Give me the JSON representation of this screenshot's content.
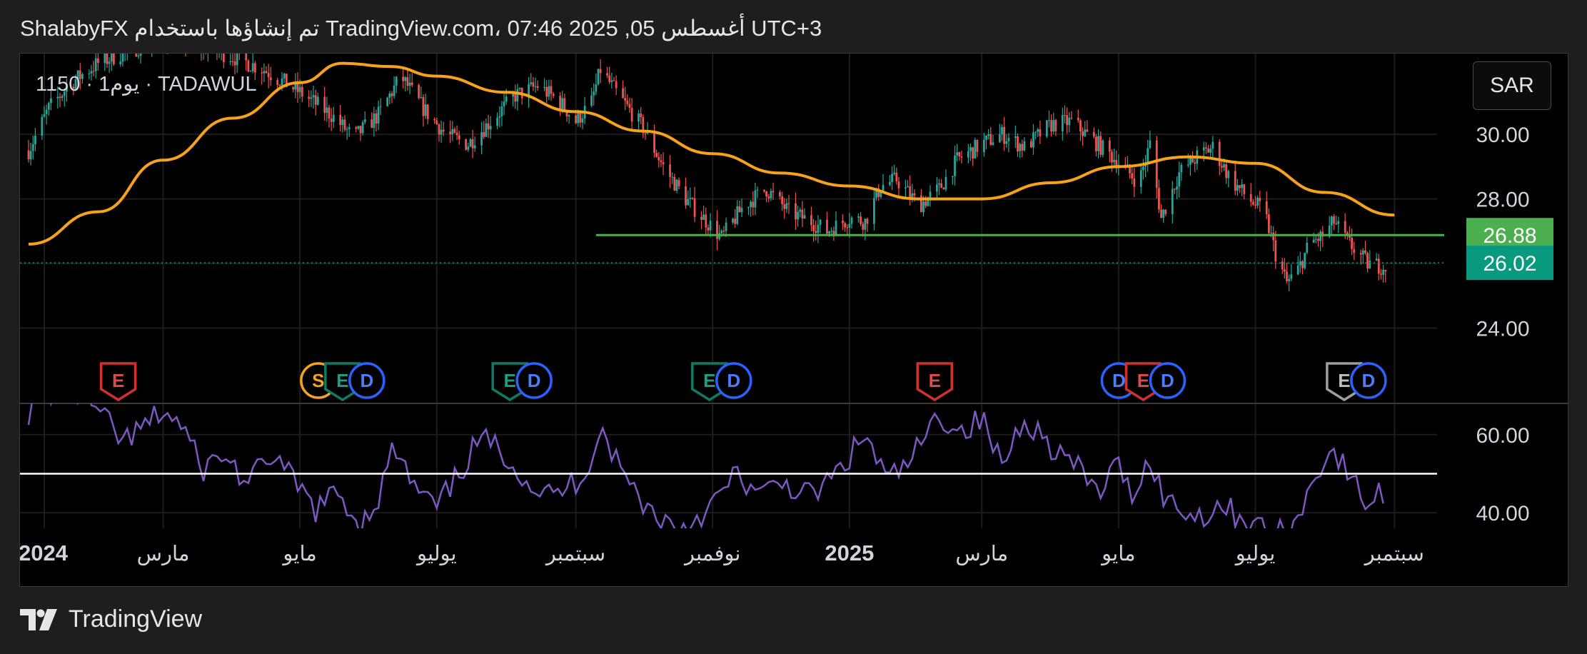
{
  "header": {
    "text": "ShalabyFX تم إنشاؤها باستخدام TradingView.com، 07:46 2025 ,05 أغسطس UTC+3"
  },
  "symbol": {
    "label": "1150 · 1يوم · TADAWUL"
  },
  "currency_button": {
    "label": "SAR"
  },
  "footer": {
    "brand": "TradingView"
  },
  "colors": {
    "up_candle": "#26a69a",
    "down_candle": "#ef5350",
    "moving_average": "#f7a21b",
    "support_line": "#4caf50",
    "current_price_tag": "#089981",
    "support_tag": "#4caf50",
    "rsi_line": "#7e57c2"
  },
  "chart_data": [
    {
      "type": "candlestick",
      "title": "",
      "xlabel": "",
      "ylabel": "",
      "x_ticks": [
        "2024",
        "مارس",
        "مايو",
        "يوليو",
        "سبتمبر",
        "نوفمبر",
        "2025",
        "مارس",
        "مايو",
        "يوليو",
        "سبتمبر"
      ],
      "y_ticks": [
        "30.00",
        "28.00",
        "24.00"
      ],
      "ylim": [
        22.0,
        32.5
      ],
      "grid": true,
      "price_points": [
        [
          "2024-01-01",
          29.5
        ],
        [
          "2024-01-10",
          30.8
        ],
        [
          "2024-01-20",
          31.6
        ],
        [
          "2024-02-01",
          32.2
        ],
        [
          "2024-02-15",
          32.6
        ],
        [
          "2024-03-01",
          33.0
        ],
        [
          "2024-03-15",
          32.8
        ],
        [
          "2024-04-01",
          32.4
        ],
        [
          "2024-04-15",
          32.0
        ],
        [
          "2024-05-01",
          31.3
        ],
        [
          "2024-05-15",
          30.6
        ],
        [
          "2024-05-25",
          29.9
        ],
        [
          "2024-06-05",
          30.6
        ],
        [
          "2024-06-15",
          31.8
        ],
        [
          "2024-06-25",
          30.8
        ],
        [
          "2024-07-05",
          30.0
        ],
        [
          "2024-07-15",
          29.7
        ],
        [
          "2024-07-25",
          30.4
        ],
        [
          "2024-08-05",
          31.2
        ],
        [
          "2024-08-15",
          31.5
        ],
        [
          "2024-08-25",
          31.0
        ],
        [
          "2024-09-01",
          30.4
        ],
        [
          "2024-09-08",
          31.0
        ],
        [
          "2024-09-12",
          32.0
        ],
        [
          "2024-09-20",
          31.2
        ],
        [
          "2024-10-01",
          30.2
        ],
        [
          "2024-10-10",
          29.0
        ],
        [
          "2024-10-20",
          28.0
        ],
        [
          "2024-10-28",
          27.4
        ],
        [
          "2024-11-05",
          26.8
        ],
        [
          "2024-11-15",
          27.8
        ],
        [
          "2024-11-25",
          28.3
        ],
        [
          "2024-12-05",
          27.6
        ],
        [
          "2024-12-15",
          27.3
        ],
        [
          "2024-12-22",
          27.0
        ],
        [
          "2025-01-01",
          27.4
        ],
        [
          "2025-01-08",
          27.3
        ],
        [
          "2025-01-15",
          28.4
        ],
        [
          "2025-01-22",
          28.6
        ],
        [
          "2025-02-01",
          27.8
        ],
        [
          "2025-02-10",
          28.3
        ],
        [
          "2025-02-18",
          29.2
        ],
        [
          "2025-03-01",
          29.7
        ],
        [
          "2025-03-10",
          30.0
        ],
        [
          "2025-03-20",
          29.6
        ],
        [
          "2025-04-01",
          30.3
        ],
        [
          "2025-04-10",
          30.4
        ],
        [
          "2025-04-20",
          29.8
        ],
        [
          "2025-04-30",
          29.2
        ],
        [
          "2025-05-10",
          28.5
        ],
        [
          "2025-05-15",
          29.7
        ],
        [
          "2025-05-20",
          27.4
        ],
        [
          "2025-05-28",
          28.8
        ],
        [
          "2025-06-05",
          29.3
        ],
        [
          "2025-06-12",
          29.6
        ],
        [
          "2025-06-20",
          28.6
        ],
        [
          "2025-06-28",
          28.0
        ],
        [
          "2025-07-05",
          27.6
        ],
        [
          "2025-07-10",
          26.3
        ],
        [
          "2025-07-15",
          25.4
        ],
        [
          "2025-07-20",
          25.8
        ],
        [
          "2025-07-25",
          26.6
        ],
        [
          "2025-08-01",
          26.9
        ],
        [
          "2025-08-05",
          27.3
        ],
        [
          "2025-08-12",
          26.6
        ],
        [
          "2025-08-20",
          26.0
        ],
        [
          "2025-08-28",
          25.9
        ],
        [
          "2025-09-01",
          26.0
        ]
      ],
      "moving_average": {
        "points": [
          [
            "2024-01-01",
            26.6
          ],
          [
            "2024-02-01",
            27.6
          ],
          [
            "2024-03-01",
            29.2
          ],
          [
            "2024-04-01",
            30.5
          ],
          [
            "2024-05-01",
            31.6
          ],
          [
            "2024-05-20",
            32.2
          ],
          [
            "2024-06-10",
            32.1
          ],
          [
            "2024-07-01",
            31.8
          ],
          [
            "2024-08-01",
            31.3
          ],
          [
            "2024-09-01",
            30.7
          ],
          [
            "2024-10-01",
            30.1
          ],
          [
            "2024-11-01",
            29.4
          ],
          [
            "2024-12-01",
            28.8
          ],
          [
            "2025-01-01",
            28.4
          ],
          [
            "2025-02-01",
            28.0
          ],
          [
            "2025-03-01",
            28.0
          ],
          [
            "2025-04-01",
            28.5
          ],
          [
            "2025-05-01",
            29.0
          ],
          [
            "2025-06-01",
            29.3
          ],
          [
            "2025-07-01",
            29.1
          ],
          [
            "2025-08-01",
            28.2
          ],
          [
            "2025-09-01",
            27.5
          ]
        ]
      },
      "support_line": {
        "value": 26.88,
        "label": "26.88",
        "from": "2024-09-10",
        "to": "2025-10-20"
      },
      "last_price": {
        "value": 26.02,
        "label": "26.02"
      },
      "events": [
        {
          "x": "2024-02-10",
          "badges": [
            "E"
          ]
        },
        {
          "x": "2024-05-20",
          "badges": [
            "S",
            "E",
            "D"
          ]
        },
        {
          "x": "2024-08-08",
          "badges": [
            "E",
            "D"
          ]
        },
        {
          "x": "2024-11-05",
          "badges": [
            "E",
            "D"
          ]
        },
        {
          "x": "2025-02-08",
          "badges": [
            "E"
          ]
        },
        {
          "x": "2025-05-12",
          "badges": [
            "D",
            "E",
            "D"
          ]
        },
        {
          "x": "2025-08-15",
          "badges": [
            "E",
            "D"
          ]
        }
      ]
    },
    {
      "type": "line",
      "title": "",
      "y_ticks": [
        "60.00",
        "40.00"
      ],
      "ylim": [
        36,
        68
      ],
      "reference_line": 50,
      "rsi": [
        [
          "2024-01-01",
          66
        ],
        [
          "2024-01-08",
          70
        ],
        [
          "2024-01-15",
          72
        ],
        [
          "2024-01-25",
          70
        ],
        [
          "2024-02-05",
          63
        ],
        [
          "2024-02-12",
          58
        ],
        [
          "2024-02-20",
          61
        ],
        [
          "2024-03-01",
          66
        ],
        [
          "2024-03-10",
          62
        ],
        [
          "2024-03-18",
          51
        ],
        [
          "2024-03-28",
          55
        ],
        [
          "2024-04-08",
          47
        ],
        [
          "2024-04-18",
          55
        ],
        [
          "2024-04-28",
          48
        ],
        [
          "2024-05-08",
          41
        ],
        [
          "2024-05-18",
          45
        ],
        [
          "2024-05-28",
          37
        ],
        [
          "2024-06-05",
          44
        ],
        [
          "2024-06-12",
          57
        ],
        [
          "2024-06-20",
          47
        ],
        [
          "2024-07-01",
          41
        ],
        [
          "2024-07-10",
          49
        ],
        [
          "2024-07-20",
          59
        ],
        [
          "2024-08-01",
          55
        ],
        [
          "2024-08-12",
          47
        ],
        [
          "2024-08-22",
          44
        ],
        [
          "2024-09-05",
          50
        ],
        [
          "2024-09-12",
          62
        ],
        [
          "2024-09-22",
          50
        ],
        [
          "2024-10-05",
          40
        ],
        [
          "2024-10-18",
          36
        ],
        [
          "2024-11-01",
          42
        ],
        [
          "2024-11-12",
          50
        ],
        [
          "2024-11-22",
          44
        ],
        [
          "2024-12-02",
          48
        ],
        [
          "2024-12-15",
          44
        ],
        [
          "2024-12-28",
          51
        ],
        [
          "2025-01-08",
          60
        ],
        [
          "2025-01-18",
          48
        ],
        [
          "2025-01-28",
          53
        ],
        [
          "2025-02-10",
          65
        ],
        [
          "2025-02-20",
          61
        ],
        [
          "2025-03-01",
          64
        ],
        [
          "2025-03-10",
          52
        ],
        [
          "2025-03-20",
          65
        ],
        [
          "2025-03-30",
          58
        ],
        [
          "2025-04-10",
          53
        ],
        [
          "2025-04-22",
          45
        ],
        [
          "2025-04-30",
          52
        ],
        [
          "2025-05-08",
          45
        ],
        [
          "2025-05-15",
          54
        ],
        [
          "2025-05-22",
          43
        ],
        [
          "2025-06-05",
          39
        ],
        [
          "2025-06-15",
          42
        ],
        [
          "2025-06-28",
          38
        ],
        [
          "2025-07-10",
          34
        ],
        [
          "2025-07-20",
          38
        ],
        [
          "2025-07-28",
          51
        ],
        [
          "2025-08-05",
          56
        ],
        [
          "2025-08-12",
          49
        ],
        [
          "2025-08-20",
          42
        ],
        [
          "2025-08-28",
          46
        ]
      ]
    }
  ]
}
